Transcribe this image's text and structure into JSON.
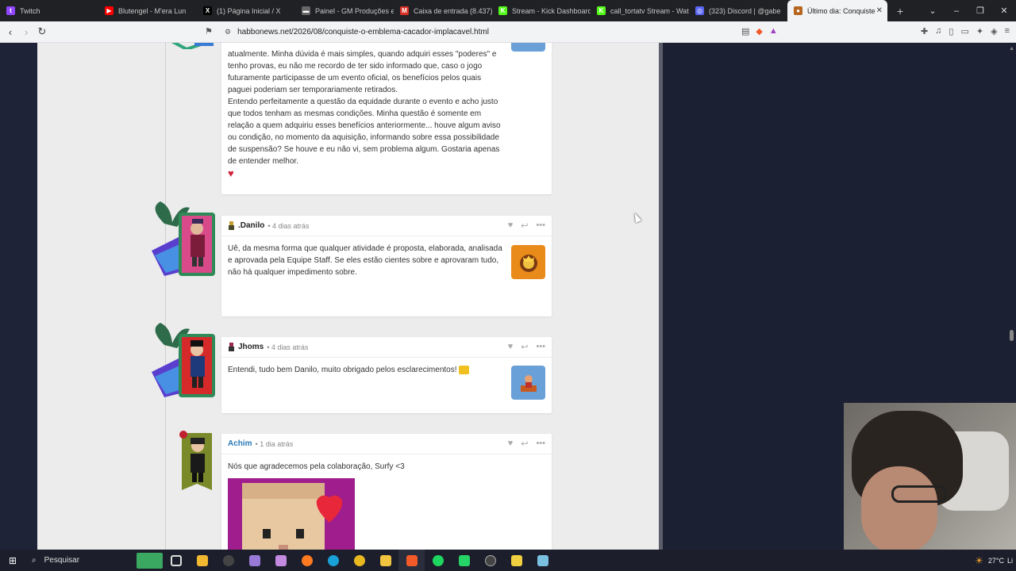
{
  "browser": {
    "tabs": [
      {
        "title": "Twitch",
        "color": "#9146ff",
        "glyph": "t"
      },
      {
        "title": "Blutengel - M'era Lun",
        "color": "#ff0000",
        "glyph": "▶"
      },
      {
        "title": "(1) Página Inicial / X",
        "color": "#000000",
        "glyph": "X"
      },
      {
        "title": "Painel - GM Produções e",
        "color": "#666666",
        "glyph": "▬"
      },
      {
        "title": "Caixa de entrada (8.437)",
        "color": "#d93025",
        "glyph": "M"
      },
      {
        "title": "Stream - Kick Dashboard",
        "color": "#53fc18",
        "glyph": "K"
      },
      {
        "title": "call_tortatv Stream - Wate",
        "color": "#53fc18",
        "glyph": "K"
      },
      {
        "title": "(323) Discord | @gabe",
        "color": "#5865f2",
        "glyph": "◎"
      },
      {
        "title": "Último dia: Conquiste",
        "color": "#b5651d",
        "glyph": "●"
      }
    ],
    "url": "habbonews.net/2026/08/conquiste-o-emblema-cacador-implacavel.html"
  },
  "comments": {
    "first_text": "atualmente. Minha dúvida é mais simples, quando adquiri esses \"poderes\" e tenho provas, eu não me recordo de ter sido informado que, caso o jogo futuramente participasse de um evento oficial, os benefícios pelos quais paguei poderiam ser temporariamente retirados.\nEntendo perfeitamente a questão da equidade durante o evento e acho justo que todos tenham as mesmas condições. Minha questão é somente em relação a quem adquiriu esses benefícios anteriormente... houve algum aviso ou condição, no momento da aquisição, informando sobre essa possibilidade de suspensão? Se houve e eu não vi, sem problema algum. Gostaria apenas de entender melhor.",
    "danilo": {
      "author": ".Danilo",
      "time": "4 dias atrás",
      "text": "Uê, da mesma forma que qualquer atividade é proposta, elaborada, analisada e aprovada pela Equipe Staff. Se eles estão cientes sobre e aprovaram tudo, não há qualquer impedimento sobre."
    },
    "jhoms": {
      "author": "Jhoms",
      "time": "4 dias atrás",
      "text": "Entendi, tudo bem Danilo, muito obrigado pelos esclarecimentos!"
    },
    "achim": {
      "author": "Achim",
      "time": "1 dia atrás",
      "text": "Nós que agradecemos pela colaboração, Surfy <3"
    }
  },
  "taskbar": {
    "search_label": "Pesquisar",
    "temperature": "27°C",
    "tray_text": "Li"
  }
}
